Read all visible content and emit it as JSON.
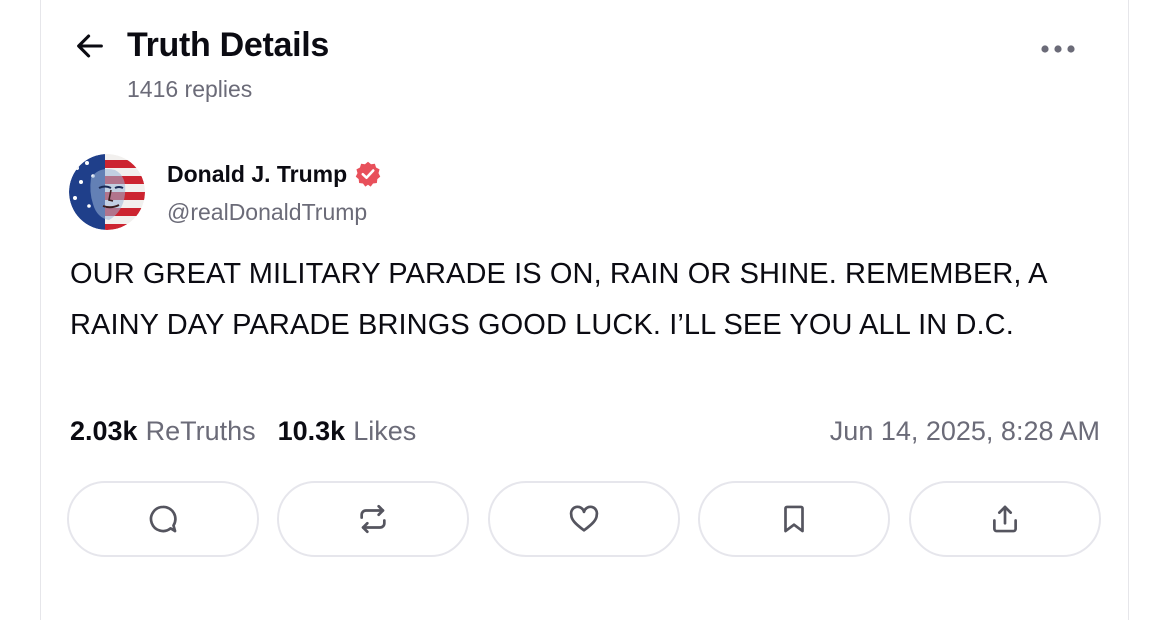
{
  "header": {
    "title": "Truth Details",
    "reply_count": "1416 replies"
  },
  "post": {
    "author_name": "Donald J. Trump",
    "handle": "@realDonaldTrump",
    "text": "OUR GREAT MILITARY PARADE IS ON, RAIN OR SHINE. REMEMBER, A RAINY DAY PARADE BRINGS GOOD LUCK. I’LL SEE YOU ALL IN D.C.",
    "retruths_count": "2.03k",
    "retruths_label": "ReTruths",
    "likes_count": "10.3k",
    "likes_label": "Likes",
    "timestamp": "Jun 14, 2025, 8:28 AM"
  },
  "actions": [
    "reply-icon",
    "retruth-icon",
    "like-icon",
    "bookmark-icon",
    "share-icon"
  ],
  "colors": {
    "verified_badge": "#e8505b",
    "text_primary": "#0b0b12",
    "text_secondary": "#6b6b78",
    "border": "#e6e6ec"
  }
}
